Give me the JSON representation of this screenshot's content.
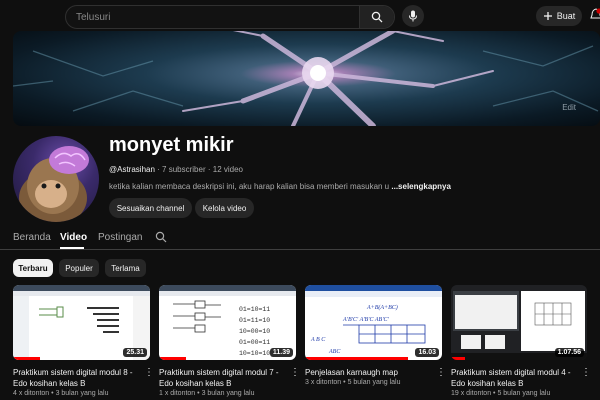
{
  "topbar": {
    "search_placeholder": "Telusuri",
    "create_label": "Buat",
    "notification_badge_color": "#cc0000"
  },
  "banner": {
    "edit_label": "Edit"
  },
  "channel": {
    "name": "monyet mikir",
    "handle": "@Astrasihan",
    "subscribers": "7 subscriber",
    "videos": "12 video",
    "description": "ketika kalian membaca deskripsi ini, aku harap kalian bisa memberi masukan u",
    "more_label": "...selengkapnya",
    "customize_label": "Sesuaikan channel",
    "manage_label": "Kelola video"
  },
  "tabs": [
    "Beranda",
    "Video",
    "Postingan"
  ],
  "active_tab": "Video",
  "chips": [
    "Terbaru",
    "Populer",
    "Terlama"
  ],
  "active_chip": "Terbaru",
  "videos": [
    {
      "title": "Praktikum sistem digital modul 8 - Edo kosihan kelas B",
      "duration": "25.31",
      "views": "4 x ditonton",
      "age": "3 bulan yang lalu",
      "watched": 0.2
    },
    {
      "title": "Praktikum sistem digital modul 7 - Edo kosihan kelas B",
      "duration": "11.39",
      "views": "1 x ditonton",
      "age": "3 bulan yang lalu",
      "watched": 0.2
    },
    {
      "title": "Penjelasan karnaugh map",
      "duration": "16.03",
      "views": "3 x ditonton",
      "age": "5 bulan yang lalu",
      "watched": 0.75
    },
    {
      "title": "Praktikum sistem digital modul 4 - Edo kosihan kelas B",
      "duration": "1.07.56",
      "views": "19 x ditonton",
      "age": "5 bulan yang lalu",
      "watched": 0.1
    }
  ],
  "thumb2_lines": [
    "01=10=11",
    "01=11=10",
    "10=00=10",
    "01=00=11",
    "10=10=10"
  ],
  "thumb3_lines": [
    "A+B(A+BC)",
    "A'B'C' A'B'C AB'C'",
    "A B C",
    "ABC"
  ],
  "accent_color": "#ff0000"
}
